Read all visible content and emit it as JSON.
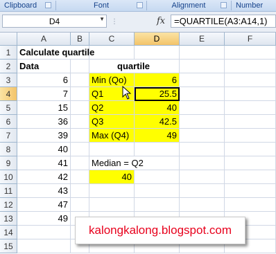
{
  "ribbon": {
    "groups": [
      {
        "label": "Clipboard"
      },
      {
        "label": "Font"
      },
      {
        "label": "Alignment"
      },
      {
        "label": "Number"
      }
    ]
  },
  "formula_bar": {
    "name_box": "D4",
    "fx_icon": "fx",
    "formula": "=QUARTILE(A3:A14,1)"
  },
  "columns": [
    "A",
    "B",
    "C",
    "D",
    "E",
    "F"
  ],
  "active_cell": "D4",
  "rows": [
    {
      "n": "1",
      "A": "Calculate quartile",
      "C": "",
      "D": ""
    },
    {
      "n": "2",
      "A": "Data",
      "C": "quartile",
      "D": ""
    },
    {
      "n": "3",
      "A": "6",
      "C": "Min (Qo)",
      "D": "6"
    },
    {
      "n": "4",
      "A": "7",
      "C": "Q1",
      "D": "25.5"
    },
    {
      "n": "5",
      "A": "15",
      "C": "Q2",
      "D": "40"
    },
    {
      "n": "6",
      "A": "36",
      "C": "Q3",
      "D": "42.5"
    },
    {
      "n": "7",
      "A": "39",
      "C": "Max (Q4)",
      "D": "49"
    },
    {
      "n": "8",
      "A": "40",
      "C": "",
      "D": ""
    },
    {
      "n": "9",
      "A": "41",
      "C": "Median = Q2",
      "D": ""
    },
    {
      "n": "10",
      "A": "42",
      "C": "40",
      "D": ""
    },
    {
      "n": "11",
      "A": "43",
      "C": "",
      "D": ""
    },
    {
      "n": "12",
      "A": "47",
      "C": "",
      "D": ""
    },
    {
      "n": "13",
      "A": "49",
      "C": "",
      "D": ""
    },
    {
      "n": "14",
      "A": "",
      "C": "",
      "D": ""
    },
    {
      "n": "15",
      "A": "",
      "C": "",
      "D": ""
    }
  ],
  "highlight_color": "#ffff00",
  "watermark": "kalongkalong.blogspot.com",
  "watermark_color": "#e8001c"
}
